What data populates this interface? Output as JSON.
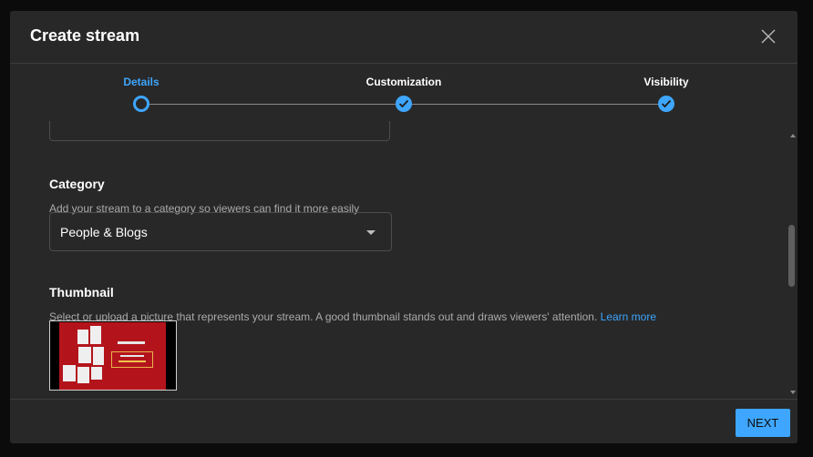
{
  "dialog": {
    "title": "Create stream",
    "close_icon": "close-icon"
  },
  "stepper": {
    "steps": [
      {
        "label": "Details",
        "state": "current"
      },
      {
        "label": "Customization",
        "state": "done"
      },
      {
        "label": "Visibility",
        "state": "done"
      }
    ]
  },
  "category": {
    "title": "Category",
    "description": "Add your stream to a category so viewers can find it more easily",
    "selected": "People & Blogs"
  },
  "thumbnail": {
    "title": "Thumbnail",
    "description": "Select or upload a picture that represents your stream. A good thumbnail stands out and draws viewers' attention.",
    "learn_more": "Learn more"
  },
  "footer": {
    "next_label": "NEXT"
  },
  "colors": {
    "accent": "#3ea6ff",
    "dialog_bg": "#282828",
    "thumb_red": "#b3141c"
  }
}
